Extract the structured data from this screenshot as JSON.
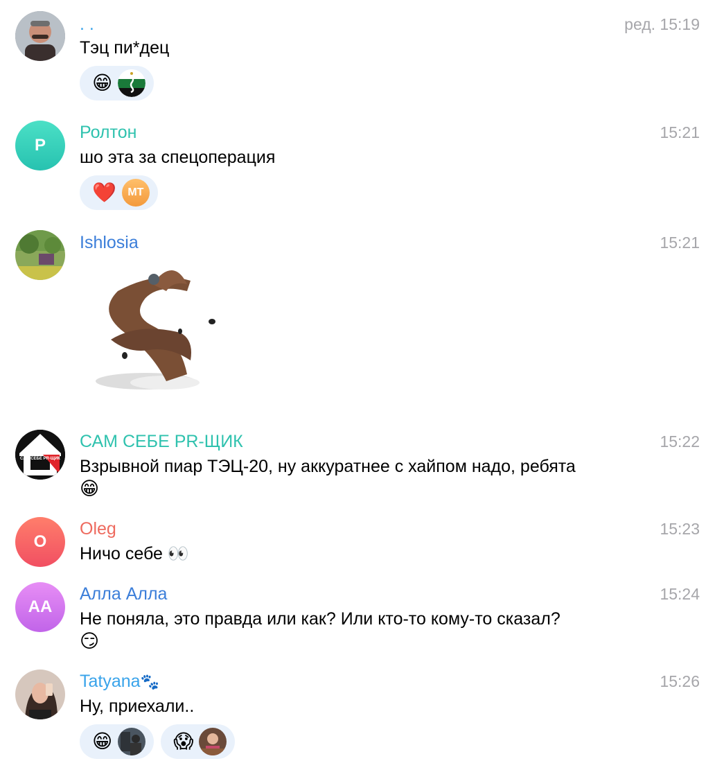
{
  "messages": [
    {
      "author": ". .",
      "author_color": "#39a3ea",
      "time": "ред. 15:19",
      "text": "Тэц пи*дец",
      "avatar_icon": "portrait-avatar",
      "reactions": [
        {
          "emoji": "😁",
          "reactor": "flag-avatar"
        }
      ]
    },
    {
      "author": "Ролтон",
      "author_color": "#2fc2ae",
      "time": "15:21",
      "text": "шо эта за спецоперация",
      "avatar_initials": "Р",
      "reactions": [
        {
          "emoji": "❤️",
          "reactor_initials": "МТ"
        }
      ]
    },
    {
      "author": "Ishlosia",
      "author_color": "#3b7ed9",
      "time": "15:21",
      "sticker": "brown-animal-sticker",
      "avatar_icon": "landscape-avatar"
    },
    {
      "author": "САМ СЕБЕ PR-ЩИК",
      "author_color": "#2fc2ae",
      "time": "15:22",
      "text_line1": "Взрывной пиар ТЭЦ-20, ну аккуратнее с хайпом надо, ребята",
      "text_line2": "😁",
      "avatar_label": "САМ СЕБЕ PR-ЩИК"
    },
    {
      "author": "Oleg",
      "author_color": "#ee6a5e",
      "time": "15:23",
      "text": "Ничо себе 👀",
      "avatar_initials": "O"
    },
    {
      "author": "Алла Алла",
      "author_color": "#3b7ed9",
      "time": "15:24",
      "text_line1": "Не поняла, это правда или как? Или кто-то кому-то сказал?",
      "text_line2": "😏",
      "avatar_initials": "АА"
    },
    {
      "author": "Tatyana",
      "author_emoji": "🐾",
      "author_color": "#39a3ea",
      "time": "15:26",
      "text": "Ну, приехали..",
      "avatar_icon": "portrait-avatar",
      "reactions": [
        {
          "emoji": "😁",
          "reactor": "photo-avatar"
        },
        {
          "emoji": "😱",
          "reactor": "photo-avatar"
        }
      ]
    }
  ]
}
